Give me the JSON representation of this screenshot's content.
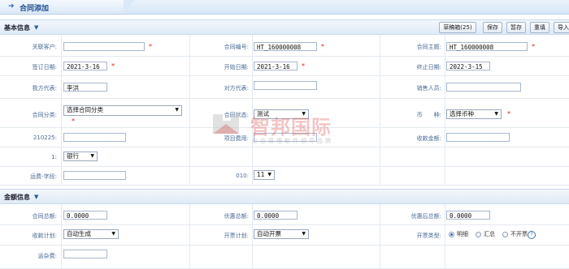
{
  "window": {
    "title": "合同添加"
  },
  "sections": {
    "basic": "基本信息",
    "amount": "金额信息"
  },
  "toolbar": {
    "draft": "草稿箱(25)",
    "save": "保存",
    "hold": "暂存",
    "reset": "重填",
    "import": "导入"
  },
  "basic": {
    "customer_label": "关联客户:",
    "customer_value": "",
    "contract_no_label": "合同编号:",
    "contract_no_value": "HT_160000008",
    "subject_label": "合同主题:",
    "subject_value": "HT_160000008",
    "sign_date_label": "签订日期:",
    "sign_date_value": "2021-3-16",
    "start_date_label": "开始日期:",
    "start_date_value": "2021-3-16",
    "end_date_label": "终止日期:",
    "end_date_value": "2022-3-15",
    "our_rep_label": "我方代表:",
    "our_rep_value": "李洪",
    "their_rep_label": "对方代表:",
    "their_rep_value": "",
    "sales_label": "销售人员:",
    "sales_value": "",
    "category_label": "合同分类:",
    "category_value": "选择合同分类",
    "status_label": "合同状态:",
    "status_value": "测试",
    "currency_label": "币　　种:",
    "currency_value": "选择币种",
    "f210225_label": "210225:",
    "f210225_value": "",
    "project_fee_label": "项目费用:",
    "project_fee_value": "",
    "received_label": "收款金额:",
    "received_value": "",
    "one_label": "1:",
    "one_value": "银行",
    "freight_label": "运费-字段:",
    "freight_value": "",
    "f010_label": "010:",
    "f010_value": "11"
  },
  "amount": {
    "total_label": "合同总额:",
    "total_value": "0.0000",
    "discount_label": "优惠总额:",
    "discount_value": "0.0000",
    "after_discount_label": "优惠后总额:",
    "after_discount_value": "0.0000",
    "collect_plan_label": "收款计划:",
    "collect_plan_value": "自动生成",
    "invoice_plan_label": "开票计划:",
    "invoice_plan_value": "自动开票",
    "invoice_type_label": "开票类型:",
    "invoice_types": [
      "明细",
      "汇总",
      "不开票"
    ],
    "invoice_type_selected": "明细",
    "misc_label": "运杂费:",
    "misc_value": ""
  },
  "watermark": {
    "text": "智邦国际",
    "sub": "企业管理软件领导品牌"
  },
  "colors": {
    "accent": "#2a6ab8",
    "required": "#d21",
    "label": "#4a6a94"
  }
}
